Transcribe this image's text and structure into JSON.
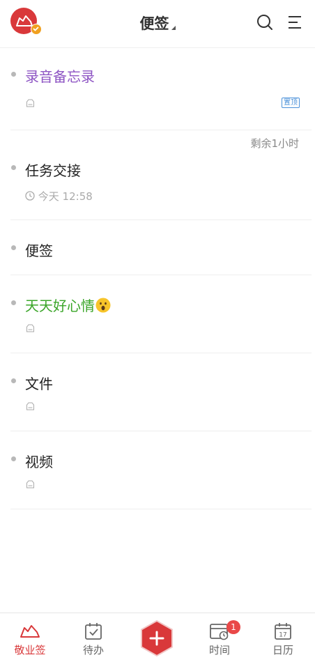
{
  "header": {
    "title": "便签",
    "icons": [
      "avatar",
      "search-icon",
      "menu-icon"
    ]
  },
  "notes": [
    {
      "title": "录音备忘录",
      "color": "#8e55c4",
      "pin": "置顶"
    },
    {
      "remaining": "剩余1小时",
      "title": "任务交接",
      "color": "#222222",
      "time": "今天 12:58"
    },
    {
      "title": "便签",
      "color": "#222222"
    },
    {
      "title": "天天好心情",
      "color": "#3aa528",
      "emoji": "astonished-face"
    },
    {
      "title": "文件",
      "color": "#222222"
    },
    {
      "title": "视频",
      "color": "#222222"
    }
  ],
  "tabs": [
    {
      "label": "敬业签",
      "icon": "cloud-logo-icon",
      "active": true
    },
    {
      "label": "待办",
      "icon": "todo-check-icon"
    },
    {
      "icon": "add-icon"
    },
    {
      "label": "时间",
      "icon": "time-calendar-icon",
      "badge": "1"
    },
    {
      "label": "日历",
      "icon": "calendar-icon",
      "day": "17"
    }
  ],
  "colors": {
    "accent": "#d9383a",
    "badge": "#e94848"
  }
}
